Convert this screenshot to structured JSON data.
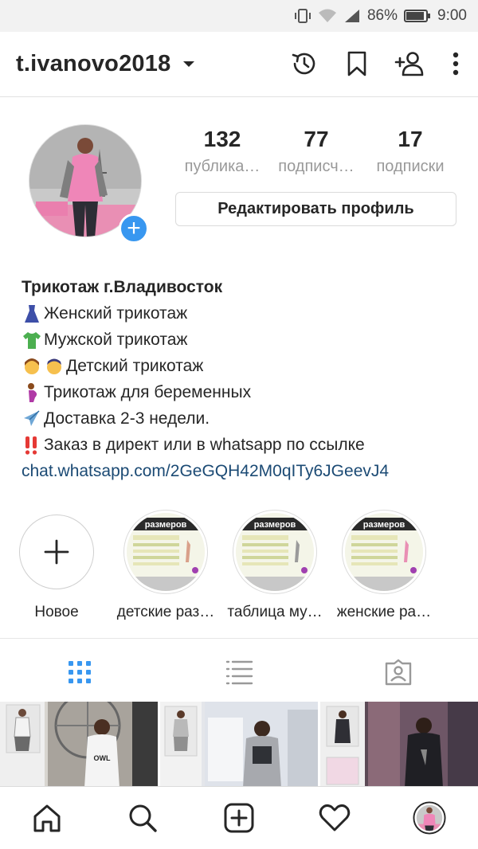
{
  "status_bar": {
    "battery": "86%",
    "time": "9:00"
  },
  "header": {
    "username": "t.ivanovo2018"
  },
  "profile": {
    "stats": [
      {
        "value": "132",
        "label": "публика…"
      },
      {
        "value": "77",
        "label": "подписч…"
      },
      {
        "value": "17",
        "label": "подписки"
      }
    ],
    "edit_button": "Редактировать профиль",
    "add_story_symbol": "+"
  },
  "bio": {
    "name": "Трикотаж г.Владивосток",
    "lines": [
      {
        "emoji": "dress-emoji",
        "text": "Женский трикотаж"
      },
      {
        "emoji": "tshirt-emoji",
        "text": "Мужской трикотаж"
      },
      {
        "emoji": "children-emoji",
        "text": "Детский трикотаж"
      },
      {
        "emoji": "pregnant-woman-emoji",
        "text": "Трикотаж для беременных"
      },
      {
        "emoji": "airplane-emoji",
        "text": "Доставка 2-3 недели."
      },
      {
        "emoji": "double-exclamation-emoji",
        "text": "Заказ в директ или в whatsapp по ссылке"
      }
    ],
    "link": "chat.whatsapp.com/2GeGQH42M0qITy6JGeevJ4"
  },
  "highlights": [
    {
      "label": "Новое",
      "type": "new"
    },
    {
      "label": "детские раз…",
      "thumb_title": "размеров"
    },
    {
      "label": "таблица му…",
      "thumb_title": "размеров"
    },
    {
      "label": "женские ра…",
      "thumb_title": "размеров"
    }
  ],
  "tabs": [
    {
      "name": "grid",
      "active": true
    },
    {
      "name": "list",
      "active": false
    },
    {
      "name": "tagged",
      "active": false
    }
  ],
  "grid_posts": [
    {
      "print": "OWL"
    },
    {
      "print": ""
    },
    {
      "print": ""
    }
  ],
  "colors": {
    "accent": "#3897f0",
    "link": "#1b4a74",
    "text": "#262626",
    "muted": "#999999"
  }
}
